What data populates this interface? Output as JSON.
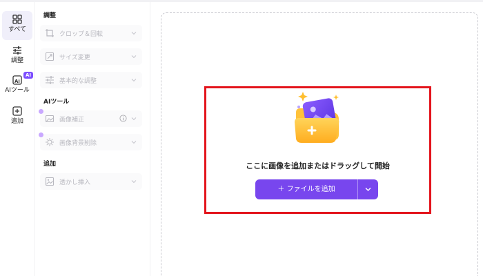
{
  "rail": {
    "items": [
      {
        "label": "すべて",
        "icon": "grid-icon",
        "active": true
      },
      {
        "label": "調整",
        "icon": "sliders-icon",
        "active": false
      },
      {
        "label": "AIツール",
        "icon": "ai-tool-icon",
        "badge": "AI",
        "active": false
      },
      {
        "label": "追加",
        "icon": "plus-square-icon",
        "active": false
      }
    ]
  },
  "panel": {
    "sections": [
      {
        "title": "調整",
        "tools": [
          {
            "label": "クロップ＆回転",
            "icon": "crop-icon"
          },
          {
            "label": "サイズ変更",
            "icon": "resize-icon"
          },
          {
            "label": "基本的な調整",
            "icon": "sliders-icon"
          }
        ]
      },
      {
        "title": "AIツール",
        "tools": [
          {
            "label": "画像補正",
            "icon": "image-enhance-icon",
            "info": true
          },
          {
            "label": "画像背景削除",
            "icon": "background-remove-icon"
          }
        ]
      },
      {
        "title": "追加",
        "tools": [
          {
            "label": "透かし挿入",
            "icon": "watermark-icon"
          }
        ]
      }
    ]
  },
  "canvas": {
    "drop_text": "ここに画像を追加またはドラッグして開始",
    "add_button_label": "＋ ファイルを追加",
    "highlight_color": "#e3141c"
  },
  "colors": {
    "accent": "#7846ee",
    "badge": "#7c4dff"
  }
}
